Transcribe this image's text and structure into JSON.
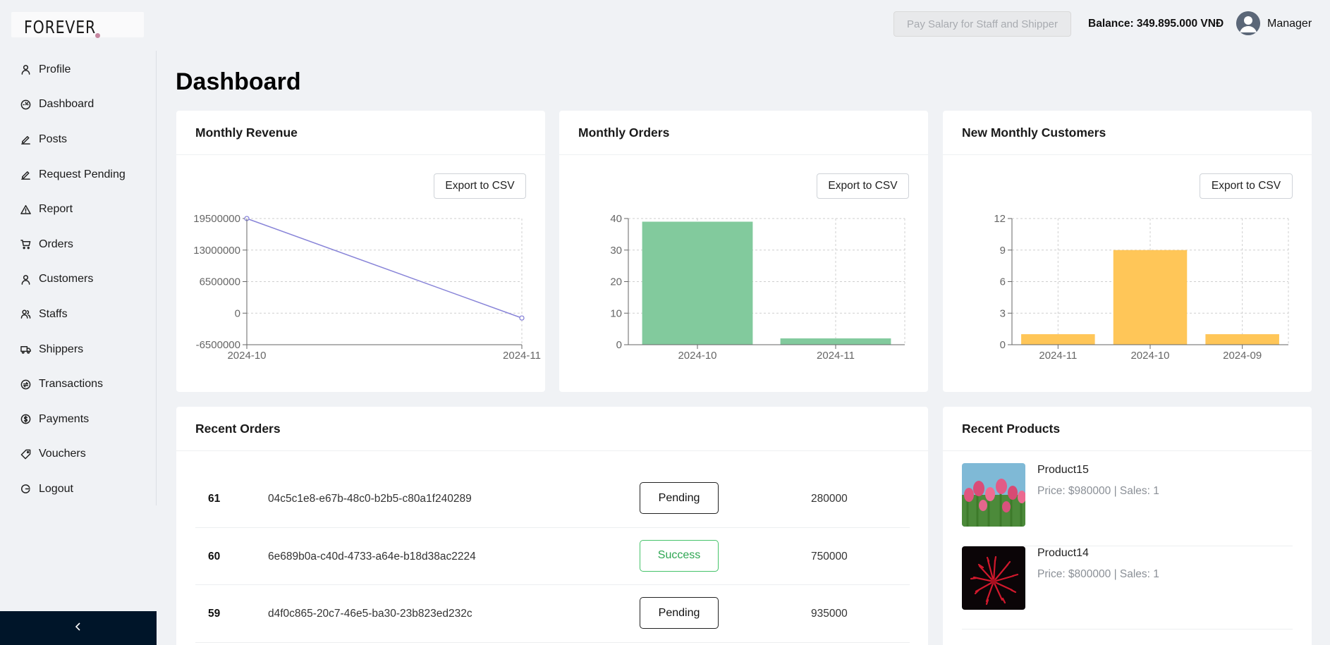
{
  "brand": {
    "logo_text": "FOREVER"
  },
  "sidebar": {
    "items": [
      {
        "label": "Profile",
        "icon": "user-icon"
      },
      {
        "label": "Dashboard",
        "icon": "dashboard-icon"
      },
      {
        "label": "Posts",
        "icon": "edit-icon"
      },
      {
        "label": "Request Pending",
        "icon": "edit-icon"
      },
      {
        "label": "Report",
        "icon": "warning-icon"
      },
      {
        "label": "Orders",
        "icon": "cart-icon"
      },
      {
        "label": "Customers",
        "icon": "user-icon"
      },
      {
        "label": "Staffs",
        "icon": "team-icon"
      },
      {
        "label": "Shippers",
        "icon": "truck-icon"
      },
      {
        "label": "Transactions",
        "icon": "transaction-icon"
      },
      {
        "label": "Payments",
        "icon": "dollar-icon"
      },
      {
        "label": "Vouchers",
        "icon": "tag-icon"
      },
      {
        "label": "Logout",
        "icon": "logout-icon"
      }
    ],
    "collapse_icon": "chevron-left-icon"
  },
  "header": {
    "pay_button": "Pay Salary for Staff and Shipper",
    "balance": "Balance: 349.895.000 VNĐ",
    "user_role": "Manager"
  },
  "page_title": "Dashboard",
  "charts": {
    "revenue": {
      "title": "Monthly Revenue",
      "export_label": "Export to CSV"
    },
    "orders": {
      "title": "Monthly Orders",
      "export_label": "Export to CSV"
    },
    "customers": {
      "title": "New Monthly Customers",
      "export_label": "Export to CSV"
    }
  },
  "chart_data": [
    {
      "type": "line",
      "title": "Monthly Revenue",
      "categories": [
        "2024-10",
        "2024-11"
      ],
      "values": [
        19500000,
        -1000000
      ],
      "yticks": [
        "-6500000",
        "0",
        "6500000",
        "13000000",
        "19500000"
      ],
      "ylim": [
        -6500000,
        19500000
      ],
      "grid": true,
      "color": "#8884d8"
    },
    {
      "type": "bar",
      "title": "Monthly Orders",
      "categories": [
        "2024-10",
        "2024-11"
      ],
      "values": [
        39,
        2
      ],
      "yticks": [
        "0",
        "10",
        "20",
        "30",
        "40"
      ],
      "ylim": [
        0,
        40
      ],
      "grid": true,
      "color": "#82ca9d"
    },
    {
      "type": "bar",
      "title": "New Monthly Customers",
      "categories": [
        "2024-11",
        "2024-10",
        "2024-09"
      ],
      "values": [
        1,
        9,
        1
      ],
      "yticks": [
        "0",
        "3",
        "6",
        "9",
        "12"
      ],
      "ylim": [
        0,
        12
      ],
      "grid": true,
      "color": "#ffc658"
    }
  ],
  "recent_orders": {
    "title": "Recent Orders",
    "rows": [
      {
        "id": "61",
        "code": "04c5c1e8-e67b-48c0-b2b5-c80a1f240289",
        "status": "Pending",
        "amount": "280000"
      },
      {
        "id": "60",
        "code": "6e689b0a-c40d-4733-a64e-b18d38ac2224",
        "status": "Success",
        "amount": "750000"
      },
      {
        "id": "59",
        "code": "d4f0c865-20c7-46e5-ba30-23b823ed232c",
        "status": "Pending",
        "amount": "935000"
      }
    ]
  },
  "recent_products": {
    "title": "Recent Products",
    "items": [
      {
        "name": "Product15",
        "meta": "Price: $980000 | Sales: 1"
      },
      {
        "name": "Product14",
        "meta": "Price: $800000 | Sales: 1"
      }
    ]
  }
}
